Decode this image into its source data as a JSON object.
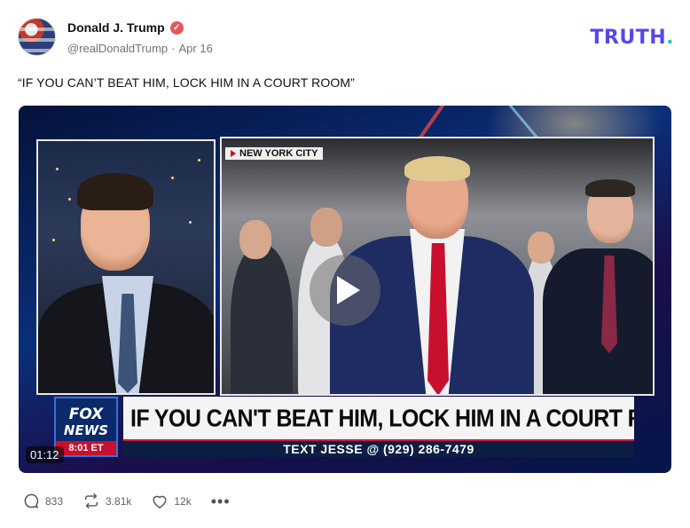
{
  "post": {
    "author": {
      "display_name": "Donald J. Trump",
      "handle": "@realDonaldTrump",
      "separator": "·",
      "date": "Apr 16",
      "verified_icon": "verified-badge-icon"
    },
    "brand": {
      "name": "TRUTH",
      "dot": ".",
      "color": "#5448ee",
      "dot_color": "#20c997"
    },
    "text": "“IF YOU CAN’T BEAT HIM, LOCK HIM IN A COURT ROOM”"
  },
  "video": {
    "location_tag": "NEW YORK CITY",
    "network_top": "FOX",
    "network_bottom": "NEWS",
    "network_time": "8:01 ET",
    "headline": "IF YOU CAN'T BEAT HIM, LOCK HIM IN A COURT ROOM",
    "subline": "TEXT JESSE @ (929) 286-7479",
    "duration": "01:12",
    "play_icon": "play-icon"
  },
  "actions": {
    "replies": "833",
    "retruths": "3.81k",
    "likes": "12k",
    "more": "•••"
  }
}
